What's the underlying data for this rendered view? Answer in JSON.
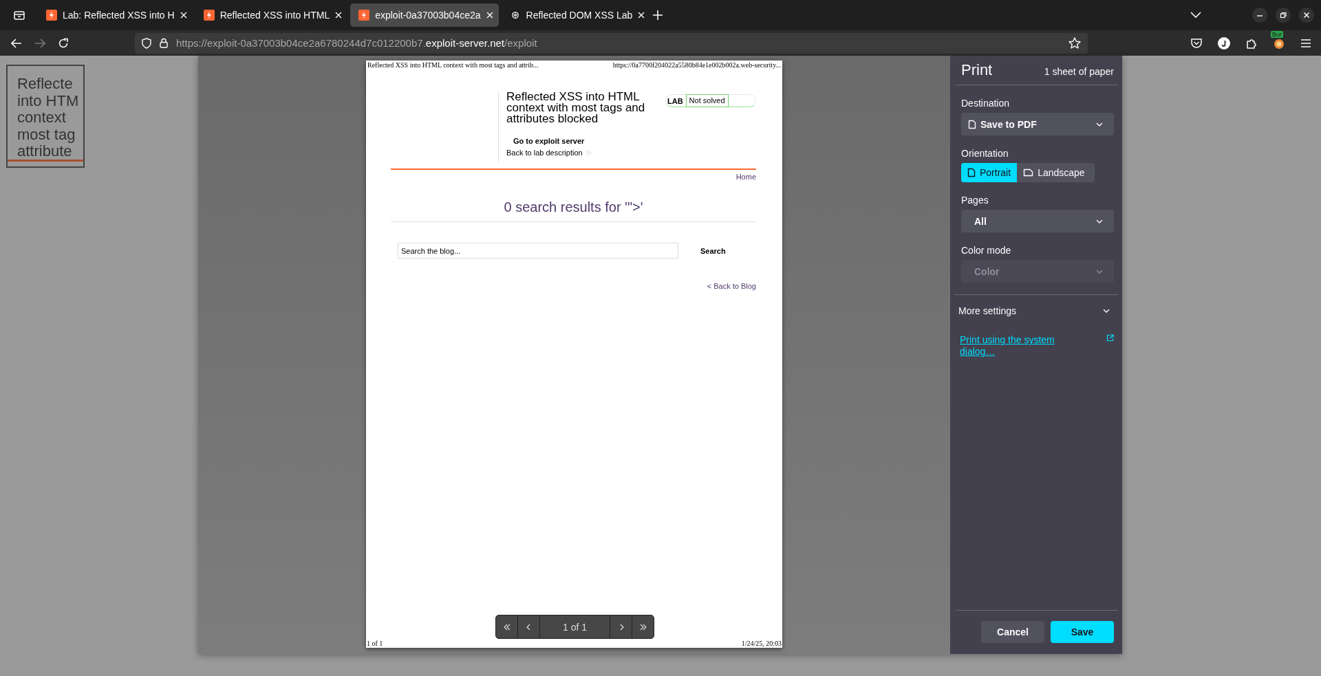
{
  "tabs": [
    {
      "title": "Lab: Reflected XSS into H",
      "kind": "flame",
      "selected": false
    },
    {
      "title": "Reflected XSS into HTML",
      "kind": "flame",
      "selected": false
    },
    {
      "title": "exploit-0a37003b04ce2a",
      "kind": "flame",
      "selected": true
    },
    {
      "title": "Reflected DOM XSS Lab",
      "kind": "knot",
      "selected": false
    }
  ],
  "address_bar": {
    "url_start": "https://exploit-0a37003b04ce2a6780244d7c012200b7.",
    "url_domain": "exploit-server.net",
    "url_path": "/exploit"
  },
  "extension_badge": "Bur",
  "background_page": {
    "lines": [
      "Reflecte",
      "into HTM",
      "context",
      "most tag",
      "attribute"
    ]
  },
  "preview": {
    "header_left": "Reflected XSS into HTML context with most tags and attrib...",
    "header_right": "https://0a7700f204022a5580b84e1e002b002a.web-security...",
    "lab_title": "Reflected XSS into HTML context with most tags and attributes blocked",
    "lab_label": "LAB",
    "lab_status": "Not solved",
    "exploit_link": "Go to exploit server",
    "description_link": "Back to lab description",
    "home_link": "Home",
    "results_heading": "0 search results for '\">'",
    "search_placeholder": "Search the blog...",
    "search_button": "Search",
    "back_link": "< Back to Blog",
    "footer_left": "1 of 1",
    "footer_right": "1/24/25, 20:03"
  },
  "page_nav": {
    "label": "1 of 1"
  },
  "print_panel": {
    "title": "Print",
    "sheets": "1 sheet of paper",
    "sections": [
      {
        "label": "Destination",
        "kind": "file-select",
        "value": "Save to PDF",
        "disabled": false
      },
      {
        "label": "Orientation",
        "kind": "toggle",
        "options": [
          {
            "label": "Portrait",
            "selected": true
          },
          {
            "label": "Landscape",
            "selected": false
          }
        ]
      },
      {
        "label": "Pages",
        "kind": "select",
        "value": "All",
        "disabled": false
      },
      {
        "label": "Color mode",
        "kind": "select",
        "value": "Color",
        "disabled": true
      }
    ],
    "more_settings": {
      "label": "More settings",
      "expanded": false
    },
    "system_link": "Print using the system dialog…",
    "buttons": [
      {
        "label": "Cancel",
        "kind": "secondary"
      },
      {
        "label": "Save",
        "kind": "primary"
      }
    ]
  }
}
